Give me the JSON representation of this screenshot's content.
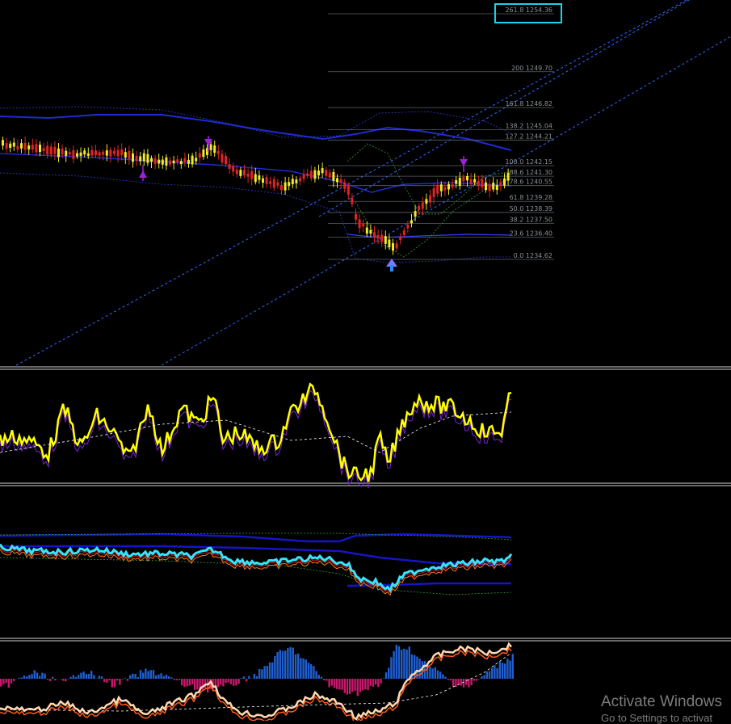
{
  "chart": {
    "background": "#000000",
    "candle_up": "#f0e82a",
    "candle_down": "#e02424",
    "ma_color": "#1e2bd0",
    "band_color": "#2f3dff",
    "channel_color": "#2a6bff"
  },
  "fibonacci_levels": [
    {
      "ratio": "261.8",
      "price": "1254.36"
    },
    {
      "ratio": "200",
      "price": "1249.70"
    },
    {
      "ratio": "161.8",
      "price": "1246.82"
    },
    {
      "ratio": "138.2",
      "price": "1245.04"
    },
    {
      "ratio": "127.2",
      "price": "1244.21"
    },
    {
      "ratio": "100.0",
      "price": "1242.15"
    },
    {
      "ratio": "88.6",
      "price": "1241.30"
    },
    {
      "ratio": "78.6",
      "price": "1240.55"
    },
    {
      "ratio": "61.8",
      "price": "1239.28"
    },
    {
      "ratio": "50.0",
      "price": "1238.39"
    },
    {
      "ratio": "38.2",
      "price": "1237.50"
    },
    {
      "ratio": "23.6",
      "price": "1236.40"
    },
    {
      "ratio": "0.0",
      "price": "1234.62"
    }
  ],
  "subwindows": {
    "oscillator_line_color": "#ffff00",
    "rsi_line_color": "#33e6ff",
    "macd_up_color": "#1f5fd1",
    "macd_down_color": "#c8186c",
    "signal_line_color": "#ffd8b0"
  },
  "watermark": {
    "title": "Activate Windows",
    "subtitle": "Go to Settings to activat"
  }
}
